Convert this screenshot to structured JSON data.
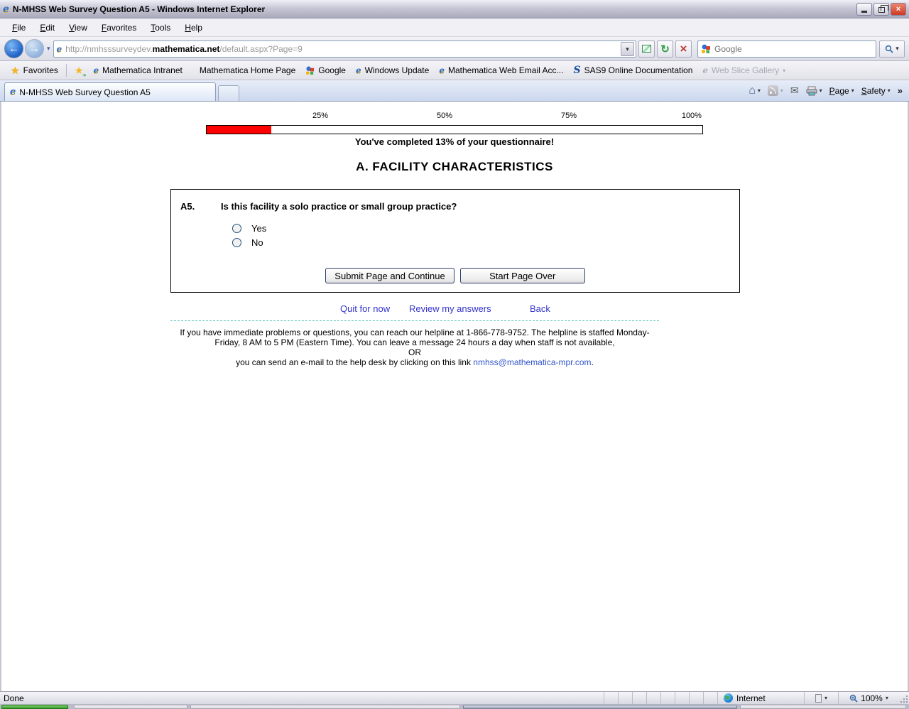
{
  "window": {
    "title": "N-MHSS Web Survey Question A5 - Windows Internet Explorer"
  },
  "menu_bar": {
    "items": [
      "File",
      "Edit",
      "View",
      "Favorites",
      "Tools",
      "Help"
    ]
  },
  "address_bar": {
    "url_prefix": "http://nmhsssurveydev.",
    "url_domain": "mathematica.net",
    "url_suffix": "/default.aspx?Page=9",
    "search_placeholder": "Google"
  },
  "favorites_bar": {
    "favorites_label": "Favorites",
    "items": [
      {
        "label": "Mathematica Intranet"
      },
      {
        "label": "Mathematica Home Page"
      },
      {
        "label": "Google"
      },
      {
        "label": "Windows Update"
      },
      {
        "label": "Mathematica Web Email Acc..."
      },
      {
        "label": "SAS9 Online Documentation"
      },
      {
        "label": "Web Slice Gallery"
      }
    ]
  },
  "tab_bar": {
    "active_tab": "N-MHSS Web Survey Question A5",
    "page_label": "Page",
    "safety_label": "Safety",
    "overflow_chevron": "»"
  },
  "icons": {
    "back": "←",
    "forward": "→",
    "dropdown": "▾",
    "refresh": "↻",
    "stop": "×",
    "favorites_star": "★",
    "ie_logo": "e",
    "sas_logo": "S",
    "home": "⌂",
    "mail": "✉",
    "print": "⎙"
  },
  "survey": {
    "progress_ticks": [
      "25%",
      "50%",
      "75%",
      "100%"
    ],
    "progress_percent": 13,
    "progress_fill_color": "#ff0000",
    "progress_message": "You've completed 13% of your questionnaire!",
    "section_title": "A. FACILITY CHARACTERISTICS",
    "question_number": "A5.",
    "question_text": "Is this facility a solo practice or small group practice?",
    "options": [
      {
        "label": "Yes"
      },
      {
        "label": "No"
      }
    ],
    "submit_label": "Submit Page and Continue",
    "start_over_label": "Start Page Over",
    "link_quit": "Quit for now",
    "link_review": "Review my answers",
    "link_back": "Back",
    "link_color": "#3333cc",
    "help_text_1": "If you have immediate problems or questions, you can reach our helpline at 1-866-778-9752. The helpline is staffed Monday-Friday, 8 AM to 5 PM (Eastern Time). You can leave a message 24 hours a day when staff is not available,",
    "help_or": "OR",
    "help_text_2": "you can send an e-mail to the help desk by clicking on this link ",
    "help_email": "nmhss@mathematica-mpr.com",
    "help_period": "."
  },
  "status_bar": {
    "status": "Done",
    "zone": "Internet",
    "zoom_level": "100%"
  }
}
